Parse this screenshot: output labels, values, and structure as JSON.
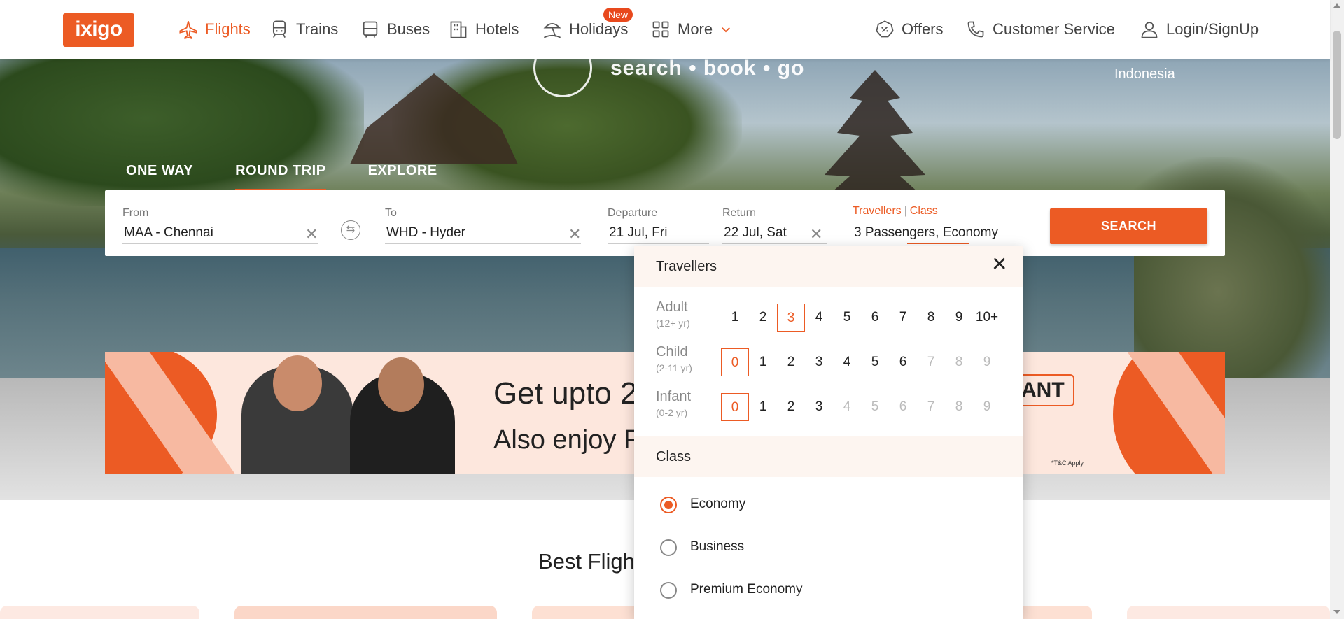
{
  "header": {
    "logo": "ixigo",
    "nav": [
      {
        "label": "Flights",
        "icon": "airplane-icon"
      },
      {
        "label": "Trains",
        "icon": "train-icon"
      },
      {
        "label": "Buses",
        "icon": "bus-icon"
      },
      {
        "label": "Hotels",
        "icon": "hotel-icon"
      },
      {
        "label": "Holidays",
        "icon": "beach-umbrella-icon"
      },
      {
        "label": "More",
        "icon": "grid-icon"
      }
    ],
    "new_badge": "New",
    "right": [
      {
        "label": "Offers",
        "icon": "offer-tag-icon"
      },
      {
        "label": "Customer Service",
        "icon": "phone-icon"
      },
      {
        "label": "Login/SignUp",
        "icon": "user-icon"
      }
    ]
  },
  "hero": {
    "tagline": "search • book • go",
    "location": "Indonesia"
  },
  "trip_tabs": [
    "ONE WAY",
    "ROUND TRIP",
    "EXPLORE"
  ],
  "search": {
    "from_label": "From",
    "from_value": "MAA - Chennai",
    "to_label": "To",
    "to_value": "WHD - Hyder",
    "departure_label": "Departure",
    "departure_value": "21 Jul, Fri",
    "return_label": "Return",
    "return_value": "22 Jul, Sat",
    "travellers_label": "Travellers",
    "class_label": "Class",
    "travellers_value": "3 Passengers, Economy",
    "button": "SEARCH"
  },
  "promo": {
    "line1": "Get upto 2",
    "line2": "Also enjoy F",
    "tag": "ANT",
    "tc": "*T&C Apply"
  },
  "best_flights": "Best Flight",
  "dropdown": {
    "title": "Travellers",
    "close": "✕",
    "adult_label": "Adult",
    "adult_sub": "(12+ yr)",
    "adult_options": [
      "1",
      "2",
      "3",
      "4",
      "5",
      "6",
      "7",
      "8",
      "9",
      "10+"
    ],
    "adult_selected": 3,
    "child_label": "Child",
    "child_sub": "(2-11 yr)",
    "child_options": [
      "0",
      "1",
      "2",
      "3",
      "4",
      "5",
      "6",
      "7",
      "8",
      "9"
    ],
    "child_selected": 0,
    "infant_label": "Infant",
    "infant_sub": "(0-2 yr)",
    "infant_options": [
      "0",
      "1",
      "2",
      "3",
      "4",
      "5",
      "6",
      "7",
      "8",
      "9"
    ],
    "infant_selected": 0,
    "class_title": "Class",
    "classes": [
      "Economy",
      "Business",
      "Premium Economy"
    ],
    "class_selected": "Economy"
  },
  "colors": {
    "accent": "#ec5b24"
  }
}
